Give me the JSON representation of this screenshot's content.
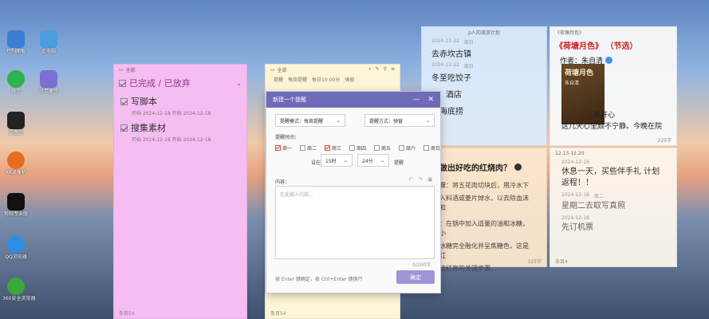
{
  "desktop": {
    "icons": [
      {
        "label": "控制面板",
        "color": "#3b7fd4"
      },
      {
        "label": "此电脑",
        "color": "#4a9ee0"
      },
      {
        "label": "微信",
        "color": "#2bb24c"
      },
      {
        "label": "好用便签",
        "color": "#7b6fd6"
      },
      {
        "label": "雷鹿宝",
        "color": "#222222"
      },
      {
        "label": "KK录像机",
        "color": "#e86d1c"
      },
      {
        "label": "剪映专业版",
        "color": "#111111"
      },
      {
        "label": "QQ浏览器",
        "color": "#2e8de0"
      },
      {
        "label": "360安全浏览器",
        "color": "#3aa83a"
      }
    ]
  },
  "pink_note": {
    "header": "全部",
    "group": "已完成 / 已放弃",
    "tasks": [
      {
        "title": "写脚本",
        "date": "开始 2024-12-18 开始 2024-12-18"
      },
      {
        "title": "搜集素材",
        "date": "开始 2024-12-18 开始 2024-12-18"
      }
    ],
    "footer": "条目54"
  },
  "yellow_note": {
    "header": "全部",
    "toolbar": [
      "提醒",
      "每周提醒",
      "每日10:00分",
      "弹窗"
    ],
    "footer": "条目54"
  },
  "dialog": {
    "title": "新建一个提醒",
    "mode_label": "提醒模式：",
    "mode_value": "每周提醒",
    "method_label": "提醒方式：",
    "method_value": "弹窗",
    "time_label": "提醒时间：",
    "weekdays": [
      {
        "label": "周一",
        "checked": true
      },
      {
        "label": "周二",
        "checked": false
      },
      {
        "label": "周三",
        "checked": true
      },
      {
        "label": "周四",
        "checked": false
      },
      {
        "label": "周五",
        "checked": false
      },
      {
        "label": "周六",
        "checked": false
      },
      {
        "label": "周日",
        "checked": false
      }
    ],
    "at_label": "设在",
    "hour_value": "15时",
    "minute_value": "24分",
    "remind_label": "提醒",
    "content_label": "内容：",
    "content_placeholder": "在此输入内容...",
    "char_count": "0/200字",
    "shortcut_hint": "按 Enter 键确定，按 Ctrl+Enter 键换行",
    "confirm_label": "确定"
  },
  "blue_note": {
    "header": "p人的旅游计划",
    "entries": [
      {
        "date": "2024-12-22",
        "time": "周日",
        "title": "去赤坎古镇"
      },
      {
        "date": "2024-12-22",
        "time": "周日",
        "title": "冬至吃饺子"
      },
      {
        "date": "",
        "time": "",
        "title": "酒店"
      },
      {
        "date": "",
        "time": "",
        "title": "吃海底捞"
      }
    ]
  },
  "book_note": {
    "header": "《荷塘月色》",
    "title": "《荷塘月色》 （节选）",
    "author": "作者：朱自清",
    "cover_title": "荷塘月色",
    "cover_author": "朱自清",
    "lines": [
      "要开心",
      "这几天心里颇不宁静。今晚在院"
    ],
    "footer": "225字"
  },
  "orange_note": {
    "title": "做出好吃的红烧肉？",
    "lines": [
      "骤：将五花肉切块后，用冷水下",
      "入料酒或姜片焯水，以去除血沫和",
      "",
      "：在锅中加入适量的油和冰糖，小",
      "冰糖完全融化并呈焦糖色，这是红",
      "烧红亮的关键步骤。"
    ],
    "footer": "325字"
  },
  "note2": {
    "header": "12.13-12.20",
    "entries": [
      {
        "date": "2024-12-18",
        "time": "",
        "title": "休息一天，买些伴手礼 计划返程！！",
        "done": false
      },
      {
        "date": "2024-12-18",
        "time": "周二",
        "title": "星期二去取写真照",
        "done": true
      },
      {
        "date": "2024-12-18",
        "time": "",
        "title": "先订机票",
        "done": true
      }
    ],
    "footer": "条目4"
  }
}
